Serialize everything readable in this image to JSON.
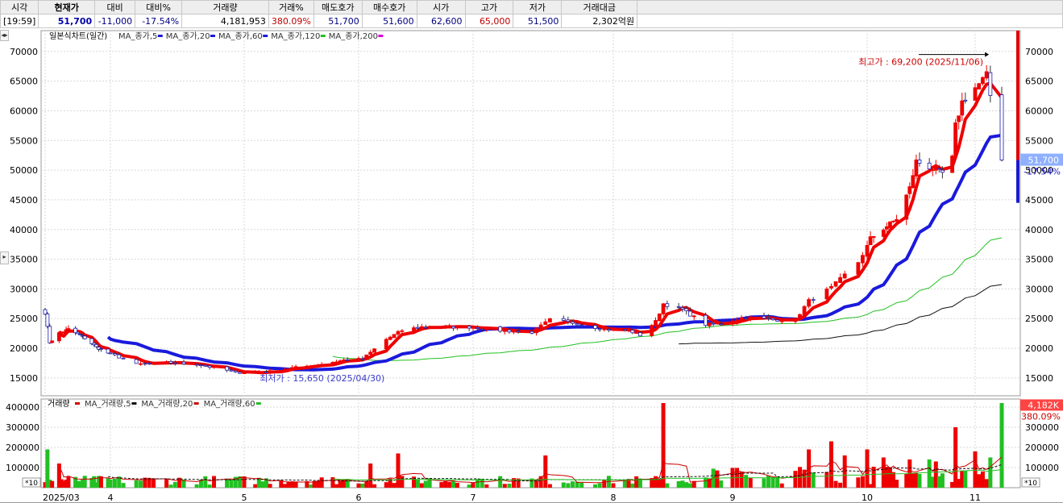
{
  "quote": {
    "headers": [
      "시각",
      "현재가",
      "대비",
      "대비%",
      "거래량",
      "거래%",
      "매도호가",
      "매수호가",
      "시가",
      "고가",
      "저가",
      "거래대금"
    ],
    "values": [
      "[19:59]",
      "51,700",
      "-11,000",
      "-17.54%",
      "4,181,953",
      "380.09%",
      "51,700",
      "51,600",
      "62,600",
      "65,000",
      "51,500",
      "2,302억원"
    ]
  },
  "colors": {
    "up": "#ee0000",
    "down": "#0000cc",
    "ma5": "#ee0000",
    "ma20": "#1a1adc",
    "ma60": "#22c022",
    "ma120": "#111111",
    "ma200": "#dd00dd",
    "volume_up": "#ee0000",
    "volume_down": "#22c022"
  },
  "nav_arrows": "◂▸",
  "side_toggle_icon": "▸",
  "price_legend": {
    "title": "일본식차트(일간)",
    "items": [
      "MA_종가,5",
      "MA_종가,20",
      "MA_종가,60",
      "MA_종가,120",
      "MA_종가,200"
    ]
  },
  "volume_legend": {
    "title": "거래량",
    "items": [
      "MA_거래량,5",
      "MA_거래량,20",
      "MA_거래량,60"
    ]
  },
  "scale_tag": "*10",
  "chart_data": {
    "type": "candlestick",
    "price_ylim": [
      12000,
      73500
    ],
    "price_ticks": [
      15000,
      20000,
      25000,
      30000,
      35000,
      40000,
      45000,
      50000,
      55000,
      60000,
      65000,
      70000
    ],
    "price_tick_labels": [
      "15000",
      "20000",
      "25000",
      "30000",
      "35000",
      "40000",
      "45000",
      "50000",
      "55000",
      "60000",
      "65000",
      "70000"
    ],
    "volume_ylim": [
      0,
      440000
    ],
    "volume_ticks": [
      100000,
      200000,
      300000,
      400000
    ],
    "volume_tick_labels": [
      "100000",
      "200000",
      "300000",
      "400000"
    ],
    "x_labels": [
      {
        "label": "2025/03",
        "date": "2025-03-04"
      },
      {
        "label": "4",
        "date": "2025-04-01"
      },
      {
        "label": "5",
        "date": "2025-05-02"
      },
      {
        "label": "6",
        "date": "2025-06-02"
      },
      {
        "label": "7",
        "date": "2025-07-01"
      },
      {
        "label": "8",
        "date": "2025-08-01"
      },
      {
        "label": "9",
        "date": "2025-09-01"
      },
      {
        "label": "10",
        "date": "2025-10-01"
      },
      {
        "label": "11",
        "date": "2025-11-03"
      }
    ],
    "price_path": [
      [
        "2025-03-04",
        26000
      ],
      [
        "2025-03-06",
        21000
      ],
      [
        "2025-03-10",
        22500
      ],
      [
        "2025-03-14",
        23200
      ],
      [
        "2025-03-20",
        22000
      ],
      [
        "2025-03-26",
        20200
      ],
      [
        "2025-04-02",
        18800
      ],
      [
        "2025-04-07",
        17300
      ],
      [
        "2025-04-14",
        17600
      ],
      [
        "2025-04-21",
        17300
      ],
      [
        "2025-04-28",
        16300
      ],
      [
        "2025-04-30",
        15900
      ],
      [
        "2025-05-08",
        16000
      ],
      [
        "2025-05-15",
        16700
      ],
      [
        "2025-05-22",
        17200
      ],
      [
        "2025-05-29",
        18000
      ],
      [
        "2025-06-03",
        18200
      ],
      [
        "2025-06-09",
        21500
      ],
      [
        "2025-06-13",
        23000
      ],
      [
        "2025-06-18",
        23600
      ],
      [
        "2025-06-24",
        23600
      ],
      [
        "2025-07-01",
        23600
      ],
      [
        "2025-07-07",
        23000
      ],
      [
        "2025-07-14",
        22700
      ],
      [
        "2025-07-18",
        24800
      ],
      [
        "2025-07-24",
        24200
      ],
      [
        "2025-07-30",
        23200
      ],
      [
        "2025-08-05",
        23000
      ],
      [
        "2025-08-08",
        22200
      ],
      [
        "2025-08-12",
        24500
      ],
      [
        "2025-08-14",
        27500
      ],
      [
        "2025-08-19",
        26500
      ],
      [
        "2025-08-25",
        24000
      ],
      [
        "2025-08-29",
        24200
      ],
      [
        "2025-09-04",
        25300
      ],
      [
        "2025-09-10",
        24800
      ],
      [
        "2025-09-15",
        24800
      ],
      [
        "2025-09-18",
        28000
      ],
      [
        "2025-09-23",
        30200
      ],
      [
        "2025-09-29",
        34500
      ],
      [
        "2025-10-02",
        38500
      ],
      [
        "2025-10-10",
        41800
      ],
      [
        "2025-10-14",
        47000
      ],
      [
        "2025-10-16",
        51500
      ],
      [
        "2025-10-20",
        50500
      ],
      [
        "2025-10-24",
        49500
      ],
      [
        "2025-10-27",
        52000
      ],
      [
        "2025-10-28",
        57500
      ],
      [
        "2025-10-30",
        61500
      ],
      [
        "2025-11-04",
        64500
      ],
      [
        "2025-11-06",
        66000
      ],
      [
        "2025-11-07",
        62600
      ],
      [
        "2025-11-10",
        51700
      ]
    ],
    "volume_bars": [
      [
        "2025-03-05",
        190000
      ],
      [
        "2025-03-10",
        120000
      ],
      [
        "2025-03-20",
        40000
      ],
      [
        "2025-06-05",
        120000
      ],
      [
        "2025-06-12",
        170000
      ],
      [
        "2025-07-17",
        160000
      ],
      [
        "2025-08-14",
        420000
      ],
      [
        "2025-09-18",
        190000
      ],
      [
        "2025-09-23",
        230000
      ],
      [
        "2025-09-26",
        160000
      ],
      [
        "2025-10-01",
        190000
      ],
      [
        "2025-10-06",
        150000
      ],
      [
        "2025-10-14",
        140000
      ],
      [
        "2025-10-20",
        140000
      ],
      [
        "2025-10-22",
        130000
      ],
      [
        "2025-10-28",
        300000
      ],
      [
        "2025-11-03",
        180000
      ],
      [
        "2025-11-07",
        150000
      ],
      [
        "2025-11-10",
        420000
      ]
    ],
    "annotations": {
      "high": {
        "text": "최고가 : 69,200 (2025/11/06)",
        "date": "2025-11-06",
        "price": 69200
      },
      "low": {
        "text": "최저가 : 15,650 (2025/04/30)",
        "date": "2025-04-30",
        "price": 15650
      }
    },
    "last_price": {
      "value": "51,700",
      "change": "-17.54%",
      "price": 51700
    },
    "last_volume": {
      "value": "4,182K",
      "ratio": "380.09%",
      "volume": 418195
    }
  }
}
